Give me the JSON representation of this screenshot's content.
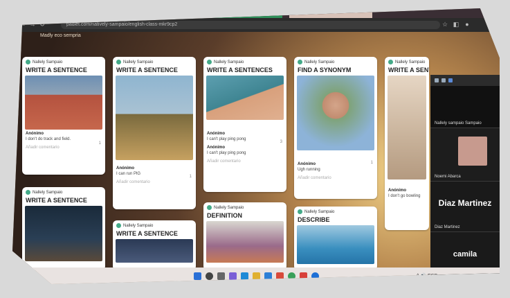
{
  "browser": {
    "url": "padlet.com/natively-sampaio/english-class-mkr9cp2",
    "board_subtitle": "Madly eco sempria"
  },
  "cards": [
    {
      "author": "Nallely Sampaio",
      "title": "WRITE A SENTENCE",
      "image": "track-runner-photo",
      "comments": [
        {
          "name": "Anónimo",
          "text": "I don't do track and field."
        }
      ],
      "count": "1",
      "reply": "Añadir comentario"
    },
    {
      "author": "Nallely Sampaio",
      "title": "WRITE A SENTENCE",
      "image": "cyclists-race-photo",
      "comments": [
        {
          "name": "Anónimo",
          "text": "I can run PlG"
        }
      ],
      "count": "1",
      "reply": "Añadir comentario"
    },
    {
      "author": "Nallely Sampaio",
      "title": "WRITE A SENTENCES",
      "image": "ping-pong-photo",
      "comments": [
        {
          "name": "Anónimo",
          "text": "I can't play ping pong"
        },
        {
          "name": "Anónimo",
          "text": "I can't play ping pong"
        }
      ],
      "count": "3",
      "reply": "Añadir comentario"
    },
    {
      "author": "Nallely Sampaio",
      "title": "FIND A SYNONYM",
      "image": "man-portrait-photo",
      "comments": [
        {
          "name": "Anónimo",
          "text": "Ugh running"
        }
      ],
      "count": "1",
      "reply": "Añadir comentario"
    },
    {
      "author": "Nallely Sampaio",
      "title": "WRITE A SENTENCE",
      "image": "dog-photo",
      "comments": [
        {
          "name": "Anónimo",
          "text": "I don't go bowling"
        }
      ],
      "count": "",
      "reply": ""
    },
    {
      "author": "Nallely Sampaio",
      "title": "WRITE A SENTENCE",
      "image": "boxing-photo",
      "comments": [],
      "count": "",
      "reply": ""
    },
    {
      "author": "Nallely Sampaio",
      "title": "WRITE A SENTENCE",
      "image": "stadium-photo",
      "comments": [],
      "count": "",
      "reply": ""
    },
    {
      "author": "Nallely Sampaio",
      "title": "DEFINITION",
      "image": "basketball-photo",
      "comments": [],
      "count": "",
      "reply": ""
    },
    {
      "author": "Nallely Sampaio",
      "title": "DESCRIBE",
      "image": "swimming-photo",
      "comments": [],
      "count": "",
      "reply": ""
    }
  ],
  "video_panel": {
    "header": "Nallely sampaio Sampaio",
    "participants": [
      {
        "label": "Noemi Abarca",
        "big": ""
      },
      {
        "label": "Diaz Martinez",
        "big": "Diaz Martinez"
      },
      {
        "label": "camila",
        "big": "camila"
      }
    ]
  },
  "taskbar": {
    "clock": "^ 🔊 ESP"
  }
}
